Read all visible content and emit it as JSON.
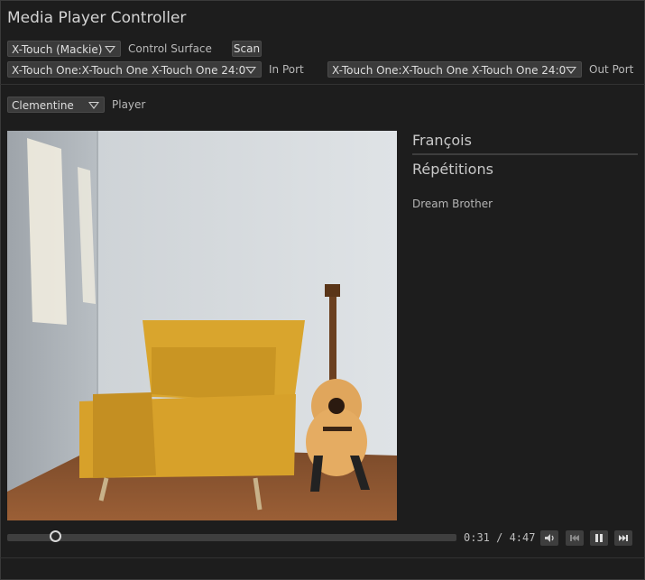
{
  "window": {
    "title": "Media Player Controller"
  },
  "surface": {
    "selected": "X-Touch (Mackie)",
    "label": "Control Surface",
    "scan_label": "Scan"
  },
  "ports": {
    "in_selected": "X-Touch One:X-Touch One X-Touch One 24:0",
    "in_label": "In Port",
    "out_selected": "X-Touch One:X-Touch One X-Touch One 24:0",
    "out_label": "Out Port"
  },
  "player": {
    "selected": "Clementine",
    "label": "Player"
  },
  "now_playing": {
    "artist": "François",
    "album": "Répétitions",
    "track": "Dream Brother"
  },
  "transport": {
    "position_text": "0:31 / 4:47",
    "progress_fraction": 0.108,
    "buttons": [
      "volume-icon",
      "previous-icon",
      "pause-icon",
      "next-icon"
    ]
  },
  "colors": {
    "background": "#1d1d1d",
    "control": "#3b3b3b",
    "text": "#c8c8c8"
  }
}
